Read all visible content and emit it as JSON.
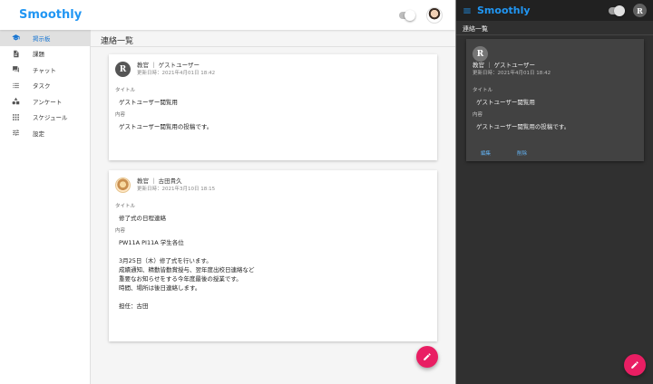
{
  "light": {
    "app_title": "Smoothly",
    "page_title": "連絡一覧",
    "nav": [
      {
        "label": "掲示板",
        "icon": "school-icon",
        "active": true
      },
      {
        "label": "課題",
        "icon": "document-icon"
      },
      {
        "label": "チャット",
        "icon": "chat-icon"
      },
      {
        "label": "タスク",
        "icon": "list-icon"
      },
      {
        "label": "アンケート",
        "icon": "shapes-icon"
      },
      {
        "label": "スケジュール",
        "icon": "grid-icon"
      },
      {
        "label": "設定",
        "icon": "tune-icon"
      }
    ],
    "posts": [
      {
        "author": "教官 ｜ ゲストユーザー",
        "updated": "更新日時：2021年4月01日 18:42",
        "title_label": "タイトル",
        "title": "ゲストユーザー閲覧用",
        "content_label": "内容",
        "content": "ゲストユーザー閲覧用の投稿です。"
      },
      {
        "author": "教官 ｜ 古田貴久",
        "updated": "更新日時：2021年3月10日 18:15",
        "title_label": "タイトル",
        "title": "修了式の日程連絡",
        "content_label": "内容",
        "content": "PW11A PI11A 学生各位\n\n3月25日（木）修了式を行います。\n成績通知、精勤皆勤賞授与、翌年度出校日連絡など\n重要なお知らせをする今年度最後の授業です。\n時間、場所は後日連絡します。\n\n担任：古田"
      }
    ]
  },
  "dark": {
    "app_title": "Smoothly",
    "avatar_letter": "R",
    "page_title": "連絡一覧",
    "post": {
      "author": "教官 ｜ ゲストユーザー",
      "updated": "更新日時：2021年4月01日 18:42",
      "title_label": "タイトル",
      "title": "ゲストユーザー閲覧用",
      "content_label": "内容",
      "content": "ゲストユーザー閲覧用の投稿です。",
      "edit_label": "編集",
      "delete_label": "削除"
    }
  },
  "colors": {
    "brand": "#2196f3",
    "fab": "#e91e63",
    "nav_active": "#1976d2",
    "dark_bg": "#303030",
    "dark_card": "#424242"
  }
}
